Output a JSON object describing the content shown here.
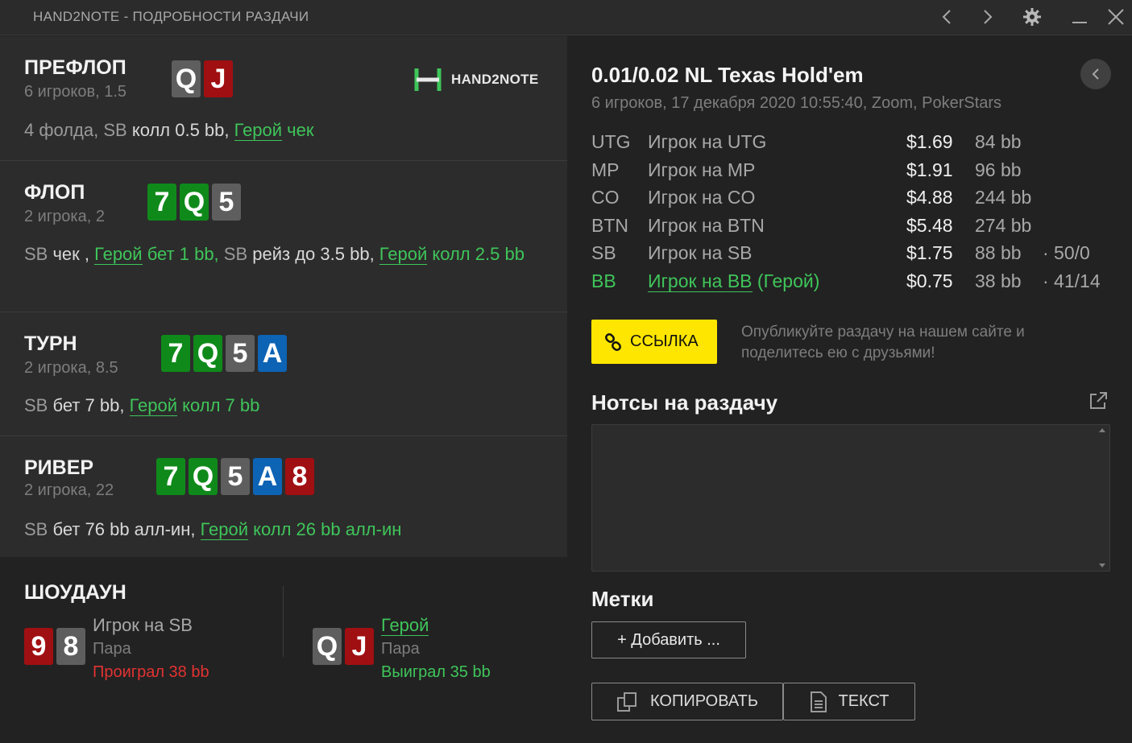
{
  "titlebar": {
    "title": "HAND2NOTE - ПОДРОБНОСТИ РАЗДАЧИ"
  },
  "logo": {
    "text": "HAND2NOTE"
  },
  "preflop": {
    "name": "ПРЕФЛОП",
    "sub": "6 игроков, 1.5",
    "cards": [
      {
        "r": "Q",
        "s": "k"
      },
      {
        "r": "J",
        "s": "r"
      }
    ],
    "a1": "4 фолда, ",
    "a2": "SB",
    "a3": " колл 0.5 bb, ",
    "hero": "Герой",
    "a4": " чек"
  },
  "flop": {
    "name": "ФЛОП",
    "sub": "2 игрока, 2",
    "cards": [
      {
        "r": "7",
        "s": "g"
      },
      {
        "r": "Q",
        "s": "g"
      },
      {
        "r": "5",
        "s": "k"
      }
    ],
    "a1": "SB",
    "a2": " чек , ",
    "hero1": "Герой",
    "a3": " бет 1 bb, ",
    "a4": "SB",
    "a5": " рейз до 3.5 bb, ",
    "hero2": "Герой",
    "a6": " колл 2.5 bb"
  },
  "turn": {
    "name": "ТУРН",
    "sub": "2 игрока, 8.5",
    "cards": [
      {
        "r": "7",
        "s": "g"
      },
      {
        "r": "Q",
        "s": "g"
      },
      {
        "r": "5",
        "s": "k"
      },
      {
        "r": "A",
        "s": "b"
      }
    ],
    "a1": "SB",
    "a2": " бет 7 bb, ",
    "hero": "Герой",
    "a3": " колл 7 bb"
  },
  "river": {
    "name": "РИВЕР",
    "sub": "2 игрока, 22",
    "cards": [
      {
        "r": "7",
        "s": "g"
      },
      {
        "r": "Q",
        "s": "g"
      },
      {
        "r": "5",
        "s": "k"
      },
      {
        "r": "A",
        "s": "b"
      },
      {
        "r": "8",
        "s": "r"
      }
    ],
    "a1": "SB",
    "a2": " бет 76 bb алл-ин, ",
    "hero": "Герой",
    "a3": " колл 26 bb алл-ин"
  },
  "showdown": {
    "name": "ШОУДАУН",
    "p1": {
      "cards": [
        {
          "r": "9",
          "s": "r"
        },
        {
          "r": "8",
          "s": "k"
        }
      ],
      "name": "Игрок на SB",
      "hand": "Пара",
      "result": "Проиграл 38 bb"
    },
    "p2": {
      "cards": [
        {
          "r": "Q",
          "s": "k"
        },
        {
          "r": "J",
          "s": "r"
        }
      ],
      "name": "Герой",
      "hand": "Пара",
      "result": "Выиграл 35 bb"
    }
  },
  "game": {
    "title": "0.01/0.02 NL Texas Hold'em",
    "sub": "6 игроков, 17 декабря 2020 10:55:40, Zoom, PokerStars"
  },
  "players": [
    {
      "pos": "UTG",
      "name": "Игрок на UTG",
      "stack": "$1.69",
      "bb": "84 bb",
      "stat": ""
    },
    {
      "pos": "MP",
      "name": "Игрок на MP",
      "stack": "$1.91",
      "bb": "96 bb",
      "stat": ""
    },
    {
      "pos": "CO",
      "name": "Игрок на CO",
      "stack": "$4.88",
      "bb": "244 bb",
      "stat": ""
    },
    {
      "pos": "BTN",
      "name": "Игрок на BTN",
      "stack": "$5.48",
      "bb": "274 bb",
      "stat": ""
    },
    {
      "pos": "SB",
      "name": "Игрок на SB",
      "stack": "$1.75",
      "bb": "88 bb",
      "stat": "·  50/0"
    },
    {
      "pos": "BB",
      "name": "Игрок на BB",
      "hero_suffix": " (Герой)",
      "stack": "$0.75",
      "bb": "38 bb",
      "stat": "·  41/14"
    }
  ],
  "link": {
    "label": "ССЫЛКА",
    "note": "Опубликуйте раздачу на нашем сайте и поделитесь ею с друзьями!"
  },
  "notes": {
    "heading": "Нотсы на раздачу",
    "value": ""
  },
  "tags": {
    "heading": "Метки",
    "add_label": "+ Добавить ..."
  },
  "buttons": {
    "copy": "КОПИРОВАТЬ",
    "text": "ТЕКСТ"
  },
  "colors": {
    "green_card": "#0f8a1a",
    "red_card": "#a00f12",
    "gray_card": "#5e5e5e",
    "blue_card": "#0d63b4",
    "hero": "#3fc55a",
    "accent": "#ffe600"
  }
}
